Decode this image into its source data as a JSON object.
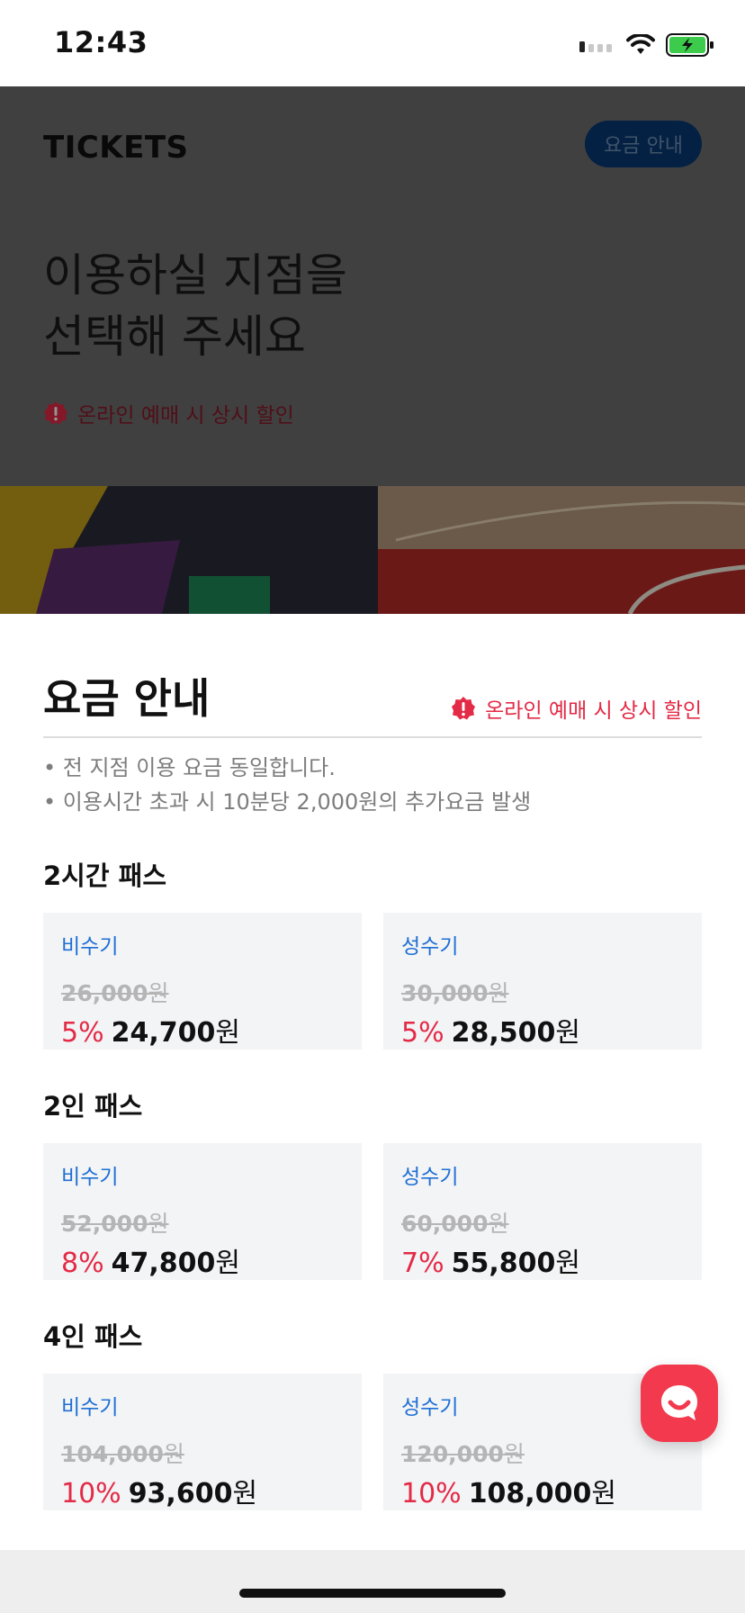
{
  "status_bar": {
    "time": "12:43"
  },
  "header": {
    "brand": "TICKETS",
    "pricing_button": "요금 안내",
    "title_line1": "이용하실 지점을",
    "title_line2": "선택해 주세요",
    "notice": "온라인 예매 시 상시 할인"
  },
  "pricing": {
    "title": "요금 안내",
    "notice": "온라인 예매 시 상시 할인",
    "bullets": [
      "• 전 지점 이용 요금 동일합니다.",
      "• 이용시간 초과 시 10분당 2,000원의 추가요금 발생"
    ],
    "groups": [
      {
        "title": "2시간 패스",
        "cards": [
          {
            "season": "비수기",
            "original": "26,000",
            "unit": "원",
            "discount": "5%",
            "price": "24,700"
          },
          {
            "season": "성수기",
            "original": "30,000",
            "unit": "원",
            "discount": "5%",
            "price": "28,500"
          }
        ]
      },
      {
        "title": "2인 패스",
        "cards": [
          {
            "season": "비수기",
            "original": "52,000",
            "unit": "원",
            "discount": "8%",
            "price": "47,800"
          },
          {
            "season": "성수기",
            "original": "60,000",
            "unit": "원",
            "discount": "7%",
            "price": "55,800"
          }
        ]
      },
      {
        "title": "4인 패스",
        "cards": [
          {
            "season": "비수기",
            "original": "104,000",
            "unit": "원",
            "discount": "10%",
            "price": "93,600"
          },
          {
            "season": "성수기",
            "original": "120,000",
            "unit": "원",
            "discount": "10%",
            "price": "108,000"
          }
        ]
      }
    ]
  },
  "colors": {
    "accent_red": "#e32a46",
    "season_blue": "#1e6fd4",
    "pill_navy": "#073a75"
  },
  "icons": [
    "wifi-icon",
    "battery-icon",
    "signal-icon",
    "alert-icon",
    "chat-icon"
  ]
}
